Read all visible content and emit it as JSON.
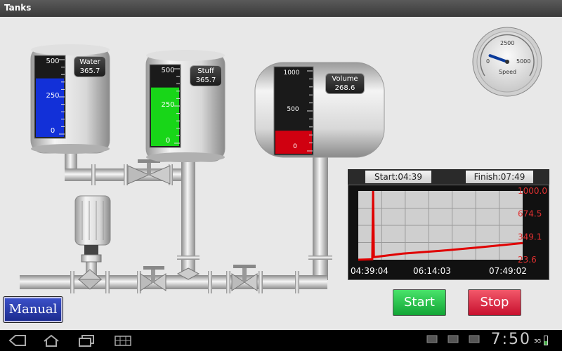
{
  "window": {
    "title": "Tanks"
  },
  "tanks": [
    {
      "name": "Water",
      "value": "365.7",
      "max": "500",
      "mid": "250",
      "min": "0",
      "fill": 0.731,
      "color": "#1230d8"
    },
    {
      "name": "Stuff",
      "value": "365.7",
      "max": "500",
      "mid": "250",
      "min": "0",
      "fill": 0.731,
      "color": "#18d618"
    },
    {
      "name": "Volume",
      "value": "268.6",
      "max": "1000",
      "mid": "500",
      "min": "0",
      "fill": 0.269,
      "color": "#d00010"
    }
  ],
  "gauge": {
    "label": "Speed",
    "min": "0",
    "mid": "2500",
    "max": "5000",
    "value": 1200
  },
  "trend": {
    "start_label": "Start:04:39",
    "finish_label": "Finish:07:49",
    "x_labels": [
      "04:39:04",
      "06:14:03",
      "07:49:02"
    ],
    "y_labels": [
      "1000.0",
      "674.5",
      "349.1",
      "23.6"
    ],
    "line_color": "#e00000"
  },
  "chart_data": {
    "type": "line",
    "x": [
      "04:39:04",
      "04:55",
      "04:56",
      "04:57",
      "05:30",
      "06:14:03",
      "07:00",
      "07:49:02"
    ],
    "values": [
      23.6,
      30,
      1000,
      60,
      110,
      150,
      200,
      260
    ],
    "ylim": [
      23.6,
      1000.0
    ],
    "grid": true
  },
  "buttons": {
    "start": "Start",
    "stop": "Stop",
    "manual": "Manual"
  },
  "statusbar": {
    "clock": "7:50",
    "network": "3G"
  }
}
